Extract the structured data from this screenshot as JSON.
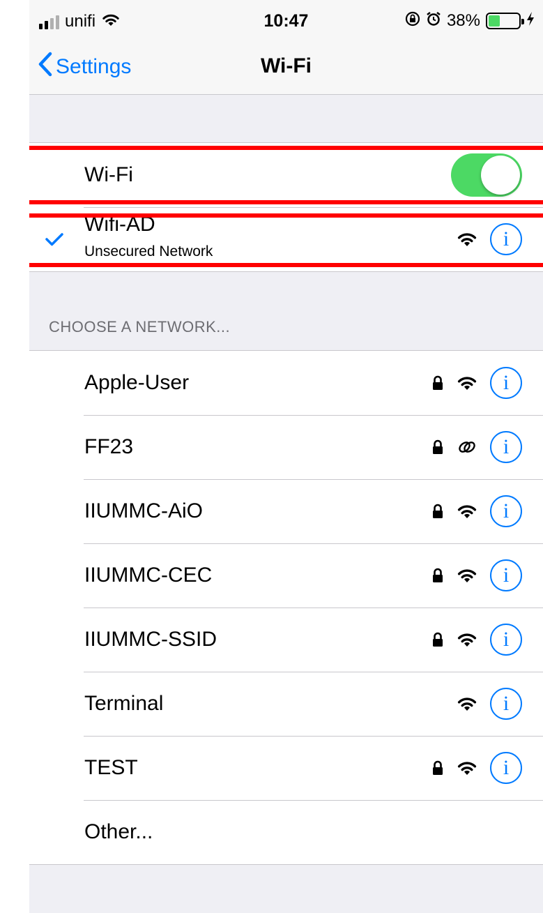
{
  "status_bar": {
    "carrier": "unifi",
    "time": "10:47",
    "battery_percent_label": "38%",
    "battery_level": 0.38
  },
  "nav": {
    "back_label": "Settings",
    "title": "Wi-Fi"
  },
  "wifi_toggle": {
    "label": "Wi-Fi",
    "on": true
  },
  "connected_network": {
    "name": "Wifi-AD",
    "subtitle": "Unsecured Network"
  },
  "section_header": "CHOOSE A NETWORK...",
  "networks": [
    {
      "name": "Apple-User",
      "locked": true,
      "icon": "wifi-icon"
    },
    {
      "name": "FF23",
      "locked": true,
      "icon": "personal-hotspot-icon"
    },
    {
      "name": "IIUMMC-AiO",
      "locked": true,
      "icon": "wifi-icon"
    },
    {
      "name": "IIUMMC-CEC",
      "locked": true,
      "icon": "wifi-icon"
    },
    {
      "name": "IIUMMC-SSID",
      "locked": true,
      "icon": "wifi-icon"
    },
    {
      "name": "Terminal",
      "locked": false,
      "icon": "wifi-icon"
    },
    {
      "name": "TEST",
      "locked": true,
      "icon": "wifi-icon"
    }
  ],
  "other_label": "Other...",
  "info_glyph": "i",
  "colors": {
    "accent": "#007aff",
    "toggle_on": "#4cd964",
    "highlight": "#ff0000",
    "background": "#efeff4"
  }
}
